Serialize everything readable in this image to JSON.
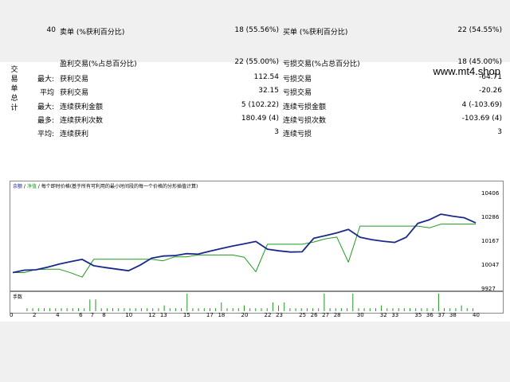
{
  "watermark": "www.mt4.shop",
  "report": {
    "side_title": [
      "交",
      "易",
      "单",
      "总",
      "计"
    ],
    "rows": [
      {
        "c0": "",
        "c1": "40",
        "c2": "卖单 (%获利百分比)",
        "c3": "18 (55.56%)",
        "c4": "买单 (%获利百分比)",
        "c5": "22 (54.55%)"
      },
      {
        "c0": "",
        "c1": "",
        "c2": "盈利交易(%占总百分比)",
        "c3": "22 (55.00%)",
        "c4": "亏损交易(%占总百分比)",
        "c5": "18 (45.00%)"
      },
      {
        "c0": "最大:",
        "c1": "",
        "c2": "获利交易",
        "c3": "112.54",
        "c4": "亏损交易",
        "c5": "-64.71"
      },
      {
        "c0": "平均",
        "c1": "",
        "c2": "获利交易",
        "c3": "32.15",
        "c4": "亏损交易",
        "c5": "-20.26"
      },
      {
        "c0": "最大:",
        "c1": "",
        "c2": "连续获利金额",
        "c3": "5 (102.22)",
        "c4": "连续亏损金额",
        "c5": "4 (-103.69)"
      },
      {
        "c0": "最多:",
        "c1": "",
        "c2": "连续获利次数",
        "c3": "180.49 (4)",
        "c4": "连续亏损次数",
        "c5": "-103.69 (4)"
      },
      {
        "c0": "平均:",
        "c1": "",
        "c2": "连续获利",
        "c3": "3",
        "c4": "连续亏损",
        "c5": "3"
      }
    ]
  },
  "chart": {
    "legend_balance": "余额",
    "legend_sep": " / ",
    "legend_equity": "净值",
    "legend_desc": " / 每个即时价格(基于所有可利用的最小时间段的每一个价格的分形插值计算)",
    "volume_label": "手数",
    "colors": {
      "balance": "#1b2a8a",
      "equity": "#1f9a1f",
      "volume": "#1f9a1f"
    }
  },
  "chart_data": {
    "type": "line",
    "x": [
      0,
      1,
      2,
      3,
      4,
      5,
      6,
      7,
      8,
      9,
      10,
      11,
      12,
      13,
      14,
      15,
      16,
      17,
      18,
      19,
      20,
      21,
      22,
      23,
      24,
      25,
      26,
      27,
      28,
      29,
      30,
      31,
      32,
      33,
      34,
      35,
      36,
      37,
      38,
      39,
      40
    ],
    "series": [
      {
        "name": "余额",
        "values": [
          10013,
          10025,
          10027,
          10040,
          10055,
          10068,
          10079,
          10047,
          10038,
          10030,
          10022,
          10050,
          10085,
          10096,
          10098,
          10108,
          10105,
          10120,
          10133,
          10146,
          10157,
          10169,
          10130,
          10122,
          10116,
          10117,
          10185,
          10198,
          10212,
          10229,
          10190,
          10178,
          10170,
          10164,
          10190,
          10260,
          10278,
          10306,
          10296,
          10288,
          10262
        ]
      },
      {
        "name": "净值",
        "values": [
          10013,
          10013,
          10028,
          10030,
          10030,
          10012,
          9990,
          10080,
          10080,
          10080,
          10080,
          10080,
          10080,
          10072,
          10092,
          10092,
          10101,
          10101,
          10101,
          10101,
          10090,
          10017,
          10155,
          10155,
          10155,
          10155,
          10166,
          10182,
          10191,
          10065,
          10246,
          10246,
          10246,
          10246,
          10246,
          10246,
          10237,
          10256,
          10256,
          10256,
          10256
        ]
      }
    ],
    "yticks": [
      10406,
      10286,
      10167,
      10047,
      9927
    ],
    "ylim": [
      9927,
      10430
    ],
    "xticks": [
      0,
      2,
      4,
      6,
      7,
      8,
      10,
      12,
      13,
      15,
      17,
      18,
      20,
      22,
      23,
      25,
      26,
      27,
      28,
      30,
      32,
      33,
      35,
      36,
      37,
      38,
      40
    ],
    "xlim": [
      0,
      40
    ],
    "volume": [
      0,
      0,
      1,
      1,
      1,
      1,
      1,
      1,
      1,
      1,
      1,
      1,
      1,
      4,
      4,
      1,
      1,
      1,
      1,
      1,
      1,
      1,
      1,
      1,
      1,
      1,
      2,
      1,
      1,
      1,
      6,
      1,
      1,
      1,
      1,
      1,
      3,
      1,
      1,
      1,
      2,
      1,
      1,
      1,
      1,
      3,
      2,
      3,
      1,
      1,
      1,
      1,
      1,
      1,
      6,
      1,
      1,
      1,
      1,
      6,
      1,
      1,
      1,
      1,
      2,
      1,
      1,
      1,
      1,
      1,
      1,
      1,
      1,
      1,
      6,
      1,
      1,
      1,
      2,
      1,
      1
    ],
    "volume_label": "手数"
  }
}
